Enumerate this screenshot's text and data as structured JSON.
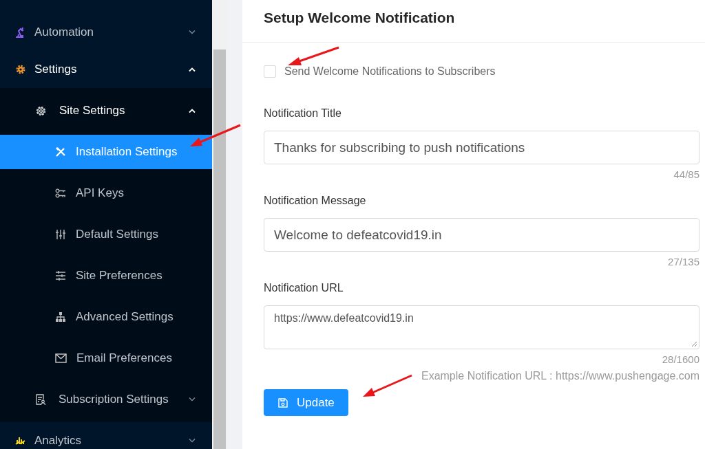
{
  "sidebar": {
    "items": [
      {
        "label": "Automation",
        "expanded": false
      },
      {
        "label": "Settings",
        "expanded": true,
        "children": [
          {
            "label": "Site Settings",
            "expanded": true,
            "children": [
              {
                "label": "Installation Settings",
                "selected": true
              },
              {
                "label": "API Keys",
                "selected": false
              },
              {
                "label": "Default Settings",
                "selected": false
              },
              {
                "label": "Site Preferences",
                "selected": false
              },
              {
                "label": "Advanced Settings",
                "selected": false
              },
              {
                "label": "Email Preferences",
                "selected": false
              }
            ]
          },
          {
            "label": "Subscription Settings",
            "expanded": false
          }
        ]
      },
      {
        "label": "Analytics",
        "expanded": false
      }
    ]
  },
  "card": {
    "title": "Setup Welcome Notification",
    "checkbox": {
      "label": "Send Welcome Notifications to Subscribers",
      "checked": false
    },
    "fields": [
      {
        "kind": "input",
        "label": "Notification Title",
        "value": "Thanks for subscribing to push notifications",
        "counter": "44/85"
      },
      {
        "kind": "input",
        "label": "Notification Message",
        "value": "Welcome to defeatcovid19.in",
        "counter": "27/135"
      },
      {
        "kind": "textarea",
        "label": "Notification URL",
        "value": "https://www.defeatcovid19.in",
        "counter": "28/1600",
        "hint": "Example Notification URL : https://www.pushengage.com"
      }
    ],
    "button": "Update"
  }
}
